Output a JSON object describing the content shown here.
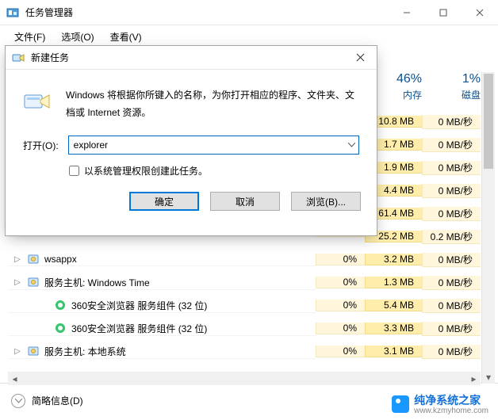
{
  "parent": {
    "title": "任务管理器",
    "menus": [
      "文件(F)",
      "选项(O)",
      "查看(V)"
    ]
  },
  "columns": {
    "cpu": {
      "value": "",
      "label": ""
    },
    "mem": {
      "value": "46%",
      "label": "内存"
    },
    "disk": {
      "value": "1%",
      "label": "磁盘"
    }
  },
  "rows": [
    {
      "indent": 0,
      "exp": false,
      "name": "",
      "cpu": "",
      "mem": "10.8 MB",
      "disk": "0 MB/秒"
    },
    {
      "indent": 0,
      "exp": false,
      "name": "",
      "cpu": "",
      "mem": "1.7 MB",
      "disk": "0 MB/秒"
    },
    {
      "indent": 0,
      "exp": false,
      "name": "",
      "cpu": "",
      "mem": "1.9 MB",
      "disk": "0 MB/秒"
    },
    {
      "indent": 0,
      "exp": false,
      "name": "",
      "cpu": "",
      "mem": "4.4 MB",
      "disk": "0 MB/秒"
    },
    {
      "indent": 0,
      "exp": false,
      "name": "",
      "cpu": "",
      "mem": "61.4 MB",
      "disk": "0 MB/秒"
    },
    {
      "indent": 0,
      "exp": false,
      "name": "",
      "cpu": "",
      "mem": "25.2 MB",
      "disk": "0.2 MB/秒"
    },
    {
      "indent": 0,
      "exp": true,
      "name": "wsappx",
      "icon": "svc",
      "cpu": "0%",
      "mem": "3.2 MB",
      "disk": "0 MB/秒"
    },
    {
      "indent": 0,
      "exp": true,
      "name": "服务主机: Windows Time",
      "icon": "svc",
      "cpu": "0%",
      "mem": "1.3 MB",
      "disk": "0 MB/秒"
    },
    {
      "indent": 1,
      "exp": false,
      "name": "360安全浏览器 服务组件 (32 位)",
      "icon": "360",
      "cpu": "0%",
      "mem": "5.4 MB",
      "disk": "0 MB/秒"
    },
    {
      "indent": 1,
      "exp": false,
      "name": "360安全浏览器 服务组件 (32 位)",
      "icon": "360",
      "cpu": "0%",
      "mem": "3.3 MB",
      "disk": "0 MB/秒"
    },
    {
      "indent": 0,
      "exp": true,
      "name": "服务主机: 本地系统",
      "icon": "svc",
      "cpu": "0%",
      "mem": "3.1 MB",
      "disk": "0 MB/秒"
    }
  ],
  "bottom": {
    "label": "简略信息(D)"
  },
  "dialog": {
    "title": "新建任务",
    "desc": "Windows 将根据你所键入的名称，为你打开相应的程序、文件夹、文档或 Internet 资源。",
    "open_label": "打开(O):",
    "input_value": "explorer",
    "admin_label": "以系统管理权限创建此任务。",
    "ok": "确定",
    "cancel": "取消",
    "browse": "浏览(B)..."
  },
  "watermark": {
    "brand": "纯净系统之家",
    "url": "www.kzmyhome.com"
  }
}
